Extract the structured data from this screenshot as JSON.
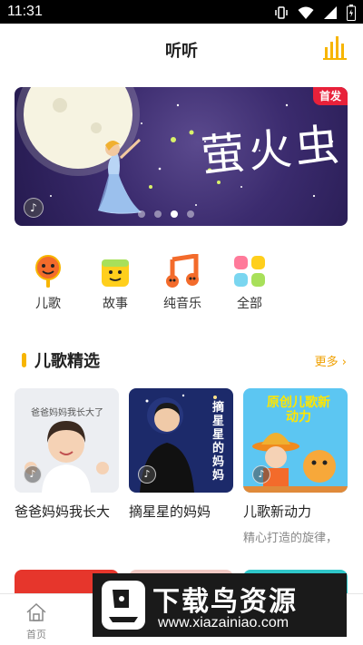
{
  "status_bar": {
    "time": "11:31"
  },
  "header": {
    "title": "听听"
  },
  "banner": {
    "badge": "首发",
    "title": "萤火虫",
    "slide_count": 4,
    "active_slide": 3
  },
  "categories": [
    {
      "label": "儿歌",
      "icon": "song-icon"
    },
    {
      "label": "故事",
      "icon": "story-icon"
    },
    {
      "label": "纯音乐",
      "icon": "music-note-icon"
    },
    {
      "label": "全部",
      "icon": "grid-icon"
    }
  ],
  "section": {
    "title": "儿歌精选",
    "more_label": "更多",
    "cards": [
      {
        "title": "爸爸妈妈我长大",
        "subtitle": "",
        "thumb_text": "爸爸妈妈我长大了"
      },
      {
        "title": "摘星星的妈妈",
        "subtitle": "",
        "thumb_text": "摘星星的妈妈"
      },
      {
        "title": "儿歌新动力",
        "subtitle": "精心打造的旋律，",
        "thumb_text": "原创儿歌新动力"
      }
    ]
  },
  "tabbar": {
    "items": [
      {
        "label": "首页",
        "icon": "home-icon"
      },
      {
        "label": "",
        "icon": "tab2-icon"
      },
      {
        "label": "",
        "icon": "tab3-icon"
      },
      {
        "label": "",
        "icon": "tab4-icon"
      },
      {
        "label": "",
        "icon": "tab5-icon"
      }
    ]
  },
  "watermark": {
    "main": "下载鸟资源",
    "url": "www.xiazainiao.com"
  },
  "colors": {
    "accent": "#f7b500",
    "badge": "#e8213a",
    "banner_bg": "#3b2b6e"
  }
}
